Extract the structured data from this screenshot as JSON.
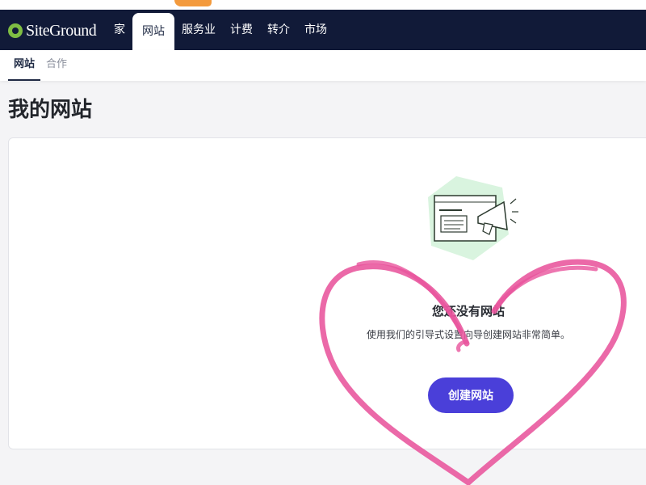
{
  "brand": {
    "name": "SiteGround",
    "colors": {
      "navbar": "#111a38",
      "logo_green": "#7fbd43",
      "primary_button": "#4a3fd9",
      "illustration_hex": "#d9f4df",
      "overlay_heart": "#e8549c"
    }
  },
  "nav": {
    "items": [
      {
        "label": "家",
        "active": false
      },
      {
        "label": "网站",
        "active": true
      },
      {
        "label": "服务业",
        "active": false
      },
      {
        "label": "计费",
        "active": false
      },
      {
        "label": "转介",
        "active": false
      },
      {
        "label": "市场",
        "active": false
      }
    ]
  },
  "subnav": {
    "items": [
      {
        "label": "网站",
        "active": true
      },
      {
        "label": "合作",
        "active": false
      }
    ]
  },
  "page": {
    "title": "我的网站"
  },
  "empty_state": {
    "illustration_icon": "website-megaphone-icon",
    "title": "您还没有网站",
    "description": "使用我们的引导式设置向导创建网站非常简单。",
    "create_button": "创建网站"
  },
  "overlay": {
    "shape": "hand-drawn-heart"
  }
}
